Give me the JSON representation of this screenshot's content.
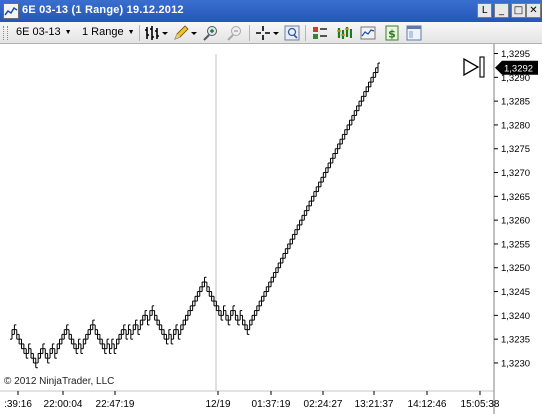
{
  "window": {
    "title": "6E 03-13 (1 Range)  19.12.2012",
    "buttons": [
      "L",
      "_",
      "□",
      "✕"
    ]
  },
  "toolbar": {
    "instrument": "6E 03-13",
    "period": "1 Range"
  },
  "chart_data": {
    "type": "line",
    "title": "",
    "x_ticks": [
      ":39:16",
      "22:00:04",
      "22:47:19",
      "12/19",
      "01:37:19",
      "02:24:27",
      "13:21:37",
      "14:12:46",
      "15:05:38"
    ],
    "y_ticks": [
      "1,3295",
      "1,3290",
      "1,3285",
      "1,3280",
      "1,3275",
      "1,3270",
      "1,3265",
      "1,3260",
      "1,3255",
      "1,3250",
      "1,3245",
      "1,3240",
      "1,3235",
      "1,3230"
    ],
    "ylim": [
      1.3226,
      1.3297
    ],
    "last_price_label": "1,3292",
    "last_price": 1.3292,
    "series": [
      {
        "values": [
          1.3236,
          1.3237,
          1.3236,
          1.3235,
          1.3234,
          1.3233,
          1.3232,
          1.3233,
          1.3232,
          1.3231,
          1.323,
          1.3231,
          1.3232,
          1.3233,
          1.3232,
          1.3231,
          1.3232,
          1.3233,
          1.3232,
          1.3233,
          1.3234,
          1.3235,
          1.3236,
          1.3237,
          1.3236,
          1.3235,
          1.3234,
          1.3233,
          1.3234,
          1.3233,
          1.3234,
          1.3235,
          1.3236,
          1.3237,
          1.3238,
          1.3237,
          1.3236,
          1.3235,
          1.3234,
          1.3233,
          1.3234,
          1.3233,
          1.3234,
          1.3233,
          1.3234,
          1.3235,
          1.3236,
          1.3237,
          1.3236,
          1.3237,
          1.3236,
          1.3237,
          1.3238,
          1.3237,
          1.3238,
          1.3239,
          1.324,
          1.3239,
          1.324,
          1.3241,
          1.324,
          1.3239,
          1.3238,
          1.3237,
          1.3236,
          1.3235,
          1.3236,
          1.3235,
          1.3236,
          1.3237,
          1.3236,
          1.3237,
          1.3238,
          1.3239,
          1.324,
          1.3241,
          1.3242,
          1.3243,
          1.3244,
          1.3245,
          1.3246,
          1.3247,
          1.3246,
          1.3245,
          1.3244,
          1.3243,
          1.3242,
          1.3241,
          1.324,
          1.3241,
          1.324,
          1.3239,
          1.324,
          1.3241,
          1.324,
          1.3239,
          1.324,
          1.3239,
          1.3238,
          1.3237,
          1.3238,
          1.3239,
          1.324,
          1.3241,
          1.3242,
          1.3243,
          1.3244,
          1.3245,
          1.3246,
          1.3247,
          1.3248,
          1.3249,
          1.325,
          1.3251,
          1.3252,
          1.3253,
          1.3254,
          1.3255,
          1.3256,
          1.3257,
          1.3258,
          1.3259,
          1.326,
          1.3261,
          1.3262,
          1.3263,
          1.3264,
          1.3265,
          1.3266,
          1.3267,
          1.3268,
          1.3269,
          1.327,
          1.3271,
          1.3272,
          1.3273,
          1.3274,
          1.3275,
          1.3276,
          1.3277,
          1.3278,
          1.3279,
          1.328,
          1.3281,
          1.3282,
          1.3283,
          1.3284,
          1.3285,
          1.3286,
          1.3287,
          1.3288,
          1.3289,
          1.329,
          1.3291,
          1.3292
        ]
      }
    ]
  },
  "footer": {
    "copyright": "© 2012 NinjaTrader, LLC"
  },
  "colors": {
    "titlebar": "#2456b8",
    "price_marker": "#000000",
    "bars": "#000000",
    "separator": "#c0c0c0"
  }
}
